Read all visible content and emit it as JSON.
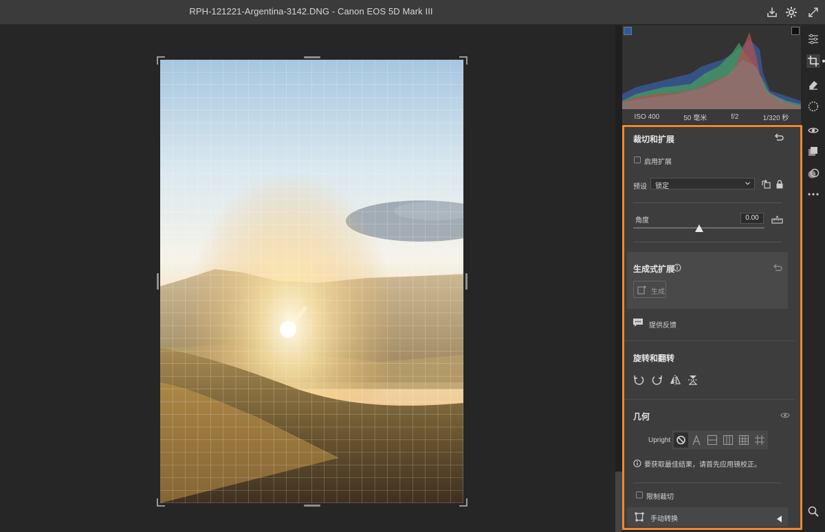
{
  "titlebar": {
    "title": "RPH-121221-Argentina-3142.DNG  -  Canon EOS 5D Mark III",
    "icons": [
      "export-icon",
      "gear-icon",
      "fullscreen-icon"
    ]
  },
  "histogram": {
    "iso": "ISO 400",
    "focal": "50 毫米",
    "aperture": "f/2",
    "shutter": "1/320 秒"
  },
  "tools": [
    "edit-sliders-icon",
    "crop-icon",
    "eraser-icon",
    "mask-icon",
    "redeye-icon",
    "presets-icon",
    "snapshots-icon",
    "more-icon",
    "zoom-icon"
  ],
  "crop_panel": {
    "title": "裁切和扩展",
    "enable_expand_label": "启用扩展",
    "preset_label": "预设",
    "preset_value": "锁定",
    "angle_label": "角度",
    "angle_value": "0.00",
    "angle_slider_value": 0.5
  },
  "generative": {
    "title": "生成式扩展",
    "generate_label": "生成"
  },
  "feedback_label": "提供反馈",
  "rotate": {
    "title": "旋转和翻转"
  },
  "geometry": {
    "title": "几何",
    "upright_label": "Upright",
    "info_text": "要获取最佳结果，请首先应用镜校正。",
    "constrain_label": "限制裁切",
    "manual_label": "手动转换"
  },
  "colors": {
    "highlight": "#f08a2c",
    "panel": "#3d3d3d"
  }
}
